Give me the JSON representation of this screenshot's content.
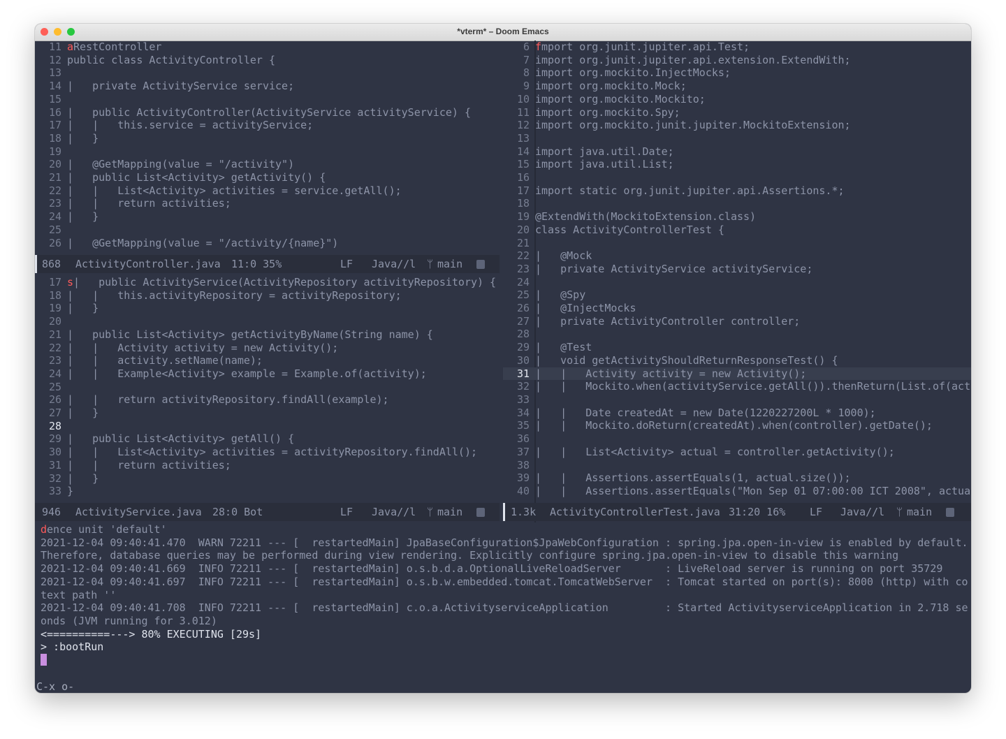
{
  "window": {
    "title": "*vterm* – Doom Emacs",
    "colors": {
      "close": "#fe5f57",
      "minimize": "#febc2e",
      "zoom": "#28c840",
      "bg": "#2f3444",
      "cursor": "#c98fe0"
    }
  },
  "pane_top_left": {
    "lines": [
      {
        "n": "11",
        "m": "a",
        "t": "RestController"
      },
      {
        "n": "12",
        "m": "",
        "t": "public class ActivityController {"
      },
      {
        "n": "13",
        "m": "",
        "t": ""
      },
      {
        "n": "14",
        "m": "",
        "t": "|   private ActivityService service;"
      },
      {
        "n": "15",
        "m": "",
        "t": ""
      },
      {
        "n": "16",
        "m": "",
        "t": "|   public ActivityController(ActivityService activityService) {"
      },
      {
        "n": "17",
        "m": "",
        "t": "|   |   this.service = activityService;"
      },
      {
        "n": "18",
        "m": "",
        "t": "|   }"
      },
      {
        "n": "19",
        "m": "",
        "t": ""
      },
      {
        "n": "20",
        "m": "",
        "t": "|   @GetMapping(value = \"/activity\")"
      },
      {
        "n": "21",
        "m": "",
        "t": "|   public List<Activity> getActivity() {"
      },
      {
        "n": "22",
        "m": "",
        "t": "|   |   List<Activity> activities = service.getAll();"
      },
      {
        "n": "23",
        "m": "",
        "t": "|   |   return activities;"
      },
      {
        "n": "24",
        "m": "",
        "t": "|   }"
      },
      {
        "n": "25",
        "m": "",
        "t": ""
      },
      {
        "n": "26",
        "m": "",
        "t": "|   @GetMapping(value = \"/activity/{name}\")"
      }
    ],
    "modeline": {
      "size": "868",
      "file": "ActivityController.java",
      "pos": "11:0 35%",
      "eol": "LF",
      "mode": "Java//l",
      "branch": "main"
    }
  },
  "pane_bottom_left": {
    "lines": [
      {
        "n": "17",
        "m": "s",
        "t": "|   public ActivityService(ActivityRepository activityRepository) {"
      },
      {
        "n": "18",
        "m": "",
        "t": "|   |   this.activityRepository = activityRepository;"
      },
      {
        "n": "19",
        "m": "",
        "t": "|   }"
      },
      {
        "n": "20",
        "m": "",
        "t": ""
      },
      {
        "n": "21",
        "m": "",
        "t": "|   public List<Activity> getActivityByName(String name) {"
      },
      {
        "n": "22",
        "m": "",
        "t": "|   |   Activity activity = new Activity();"
      },
      {
        "n": "23",
        "m": "",
        "t": "|   |   activity.setName(name);"
      },
      {
        "n": "24",
        "m": "",
        "t": "|   |   Example<Activity> example = Example.of(activity);"
      },
      {
        "n": "25",
        "m": "",
        "t": ""
      },
      {
        "n": "26",
        "m": "",
        "t": "|   |   return activityRepository.findAll(example);"
      },
      {
        "n": "27",
        "m": "",
        "t": "|   }"
      },
      {
        "n": "28",
        "m": "",
        "t": "",
        "cur": true
      },
      {
        "n": "29",
        "m": "",
        "t": "|   public List<Activity> getAll() {"
      },
      {
        "n": "30",
        "m": "",
        "t": "|   |   List<Activity> activities = activityRepository.findAll();"
      },
      {
        "n": "31",
        "m": "",
        "t": "|   |   return activities;"
      },
      {
        "n": "32",
        "m": "",
        "t": "|   }"
      },
      {
        "n": "33",
        "m": "",
        "t": "}"
      }
    ],
    "modeline": {
      "size": "946",
      "file": "ActivityService.java",
      "pos": "28:0 Bot",
      "eol": "LF",
      "mode": "Java//l",
      "branch": "main"
    }
  },
  "pane_right": {
    "lines": [
      {
        "n": "6",
        "m": "f",
        "t": "mport org.junit.jupiter.api.Test;"
      },
      {
        "n": "7",
        "m": "",
        "t": "import org.junit.jupiter.api.extension.ExtendWith;"
      },
      {
        "n": "8",
        "m": "",
        "t": "import org.mockito.InjectMocks;"
      },
      {
        "n": "9",
        "m": "",
        "t": "import org.mockito.Mock;"
      },
      {
        "n": "10",
        "m": "",
        "t": "import org.mockito.Mockito;"
      },
      {
        "n": "11",
        "m": "",
        "t": "import org.mockito.Spy;"
      },
      {
        "n": "12",
        "m": "",
        "t": "import org.mockito.junit.jupiter.MockitoExtension;"
      },
      {
        "n": "13",
        "m": "",
        "t": ""
      },
      {
        "n": "14",
        "m": "",
        "t": "import java.util.Date;"
      },
      {
        "n": "15",
        "m": "",
        "t": "import java.util.List;"
      },
      {
        "n": "16",
        "m": "",
        "t": ""
      },
      {
        "n": "17",
        "m": "",
        "t": "import static org.junit.jupiter.api.Assertions.*;"
      },
      {
        "n": "18",
        "m": "",
        "t": ""
      },
      {
        "n": "19",
        "m": "",
        "t": "@ExtendWith(MockitoExtension.class)"
      },
      {
        "n": "20",
        "m": "",
        "t": "class ActivityControllerTest {"
      },
      {
        "n": "21",
        "m": "",
        "t": ""
      },
      {
        "n": "22",
        "m": "",
        "t": "|   @Mock"
      },
      {
        "n": "23",
        "m": "",
        "t": "|   private ActivityService activityService;"
      },
      {
        "n": "24",
        "m": "",
        "t": ""
      },
      {
        "n": "25",
        "m": "",
        "t": "|   @Spy"
      },
      {
        "n": "26",
        "m": "",
        "t": "|   @InjectMocks"
      },
      {
        "n": "27",
        "m": "",
        "t": "|   private ActivityController controller;"
      },
      {
        "n": "28",
        "m": "",
        "t": ""
      },
      {
        "n": "29",
        "m": "",
        "t": "|   @Test"
      },
      {
        "n": "30",
        "m": "",
        "t": "|   void getActivityShouldReturnResponseTest() {"
      },
      {
        "n": "31",
        "m": "",
        "t": "|   |   Activity activity = new Activity();",
        "cur": true
      },
      {
        "n": "32",
        "m": "",
        "t": "|   |   Mockito.when(activityService.getAll()).thenReturn(List.of(acti"
      },
      {
        "n": "33",
        "m": "",
        "t": ""
      },
      {
        "n": "34",
        "m": "",
        "t": "|   |   Date createdAt = new Date(1220227200L * 1000);"
      },
      {
        "n": "35",
        "m": "",
        "t": "|   |   Mockito.doReturn(createdAt).when(controller).getDate();"
      },
      {
        "n": "36",
        "m": "",
        "t": ""
      },
      {
        "n": "37",
        "m": "",
        "t": "|   |   List<Activity> actual = controller.getActivity();"
      },
      {
        "n": "38",
        "m": "",
        "t": ""
      },
      {
        "n": "39",
        "m": "",
        "t": "|   |   Assertions.assertEquals(1, actual.size());"
      },
      {
        "n": "40",
        "m": "",
        "t": "|   |   Assertions.assertEquals(\"Mon Sep 01 07:00:00 ICT 2008\", actual"
      }
    ],
    "modeline": {
      "size": "1.3k",
      "file": "ActivityControllerTest.java",
      "pos": "31:20 16%",
      "eol": "LF",
      "mode": "Java//l",
      "branch": "main"
    }
  },
  "terminal": {
    "lines": [
      {
        "mark": "d",
        "t": "ence unit 'default'"
      },
      {
        "t": "2021-12-04 09:40:41.470  WARN 72211 --- [  restartedMain] JpaBaseConfiguration$JpaWebConfiguration : spring.jpa.open-in-view is enabled by default. $"
      },
      {
        "t": "Therefore, database queries may be performed during view rendering. Explicitly configure spring.jpa.open-in-view to disable this warning"
      },
      {
        "t": "2021-12-04 09:40:41.669  INFO 72211 --- [  restartedMain] o.s.b.d.a.OptionalLiveReloadServer       : LiveReload server is running on port 35729"
      },
      {
        "t": "2021-12-04 09:40:41.697  INFO 72211 --- [  restartedMain] o.s.b.w.embedded.tomcat.TomcatWebServer  : Tomcat started on port(s): 8000 (http) with co $"
      },
      {
        "t": "text path ''"
      },
      {
        "t": "2021-12-04 09:40:41.708  INFO 72211 --- [  restartedMain] c.o.a.ActivityserviceApplication         : Started ActivityserviceApplication in 2.718 se $"
      },
      {
        "t": "onds (JVM running for 3.012)"
      },
      {
        "t": "<==========---> 80% EXECUTING [29s]",
        "bright": true
      },
      {
        "t": "> :bootRun",
        "bright": true
      }
    ],
    "minibuffer": "C-x o-"
  }
}
